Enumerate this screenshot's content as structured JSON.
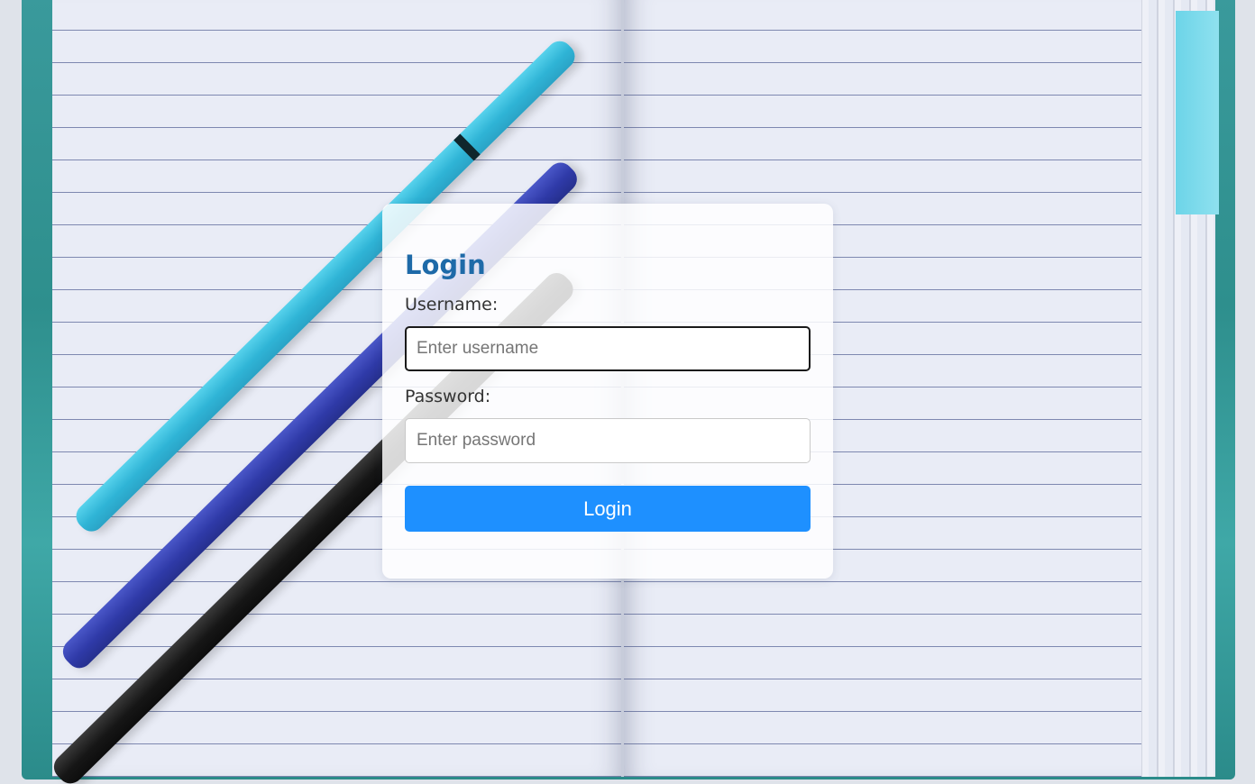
{
  "login": {
    "title": "Login",
    "username_label": "Username:",
    "username_placeholder": "Enter username",
    "username_value": "",
    "password_label": "Password:",
    "password_placeholder": "Enter password",
    "password_value": "",
    "button_label": "Login"
  },
  "background": {
    "description_icon": "notebook-with-pens-photo"
  },
  "colors": {
    "title": "#1e6aa8",
    "button": "#1e90ff",
    "button_text": "#ffffff",
    "label_text": "#333333"
  }
}
